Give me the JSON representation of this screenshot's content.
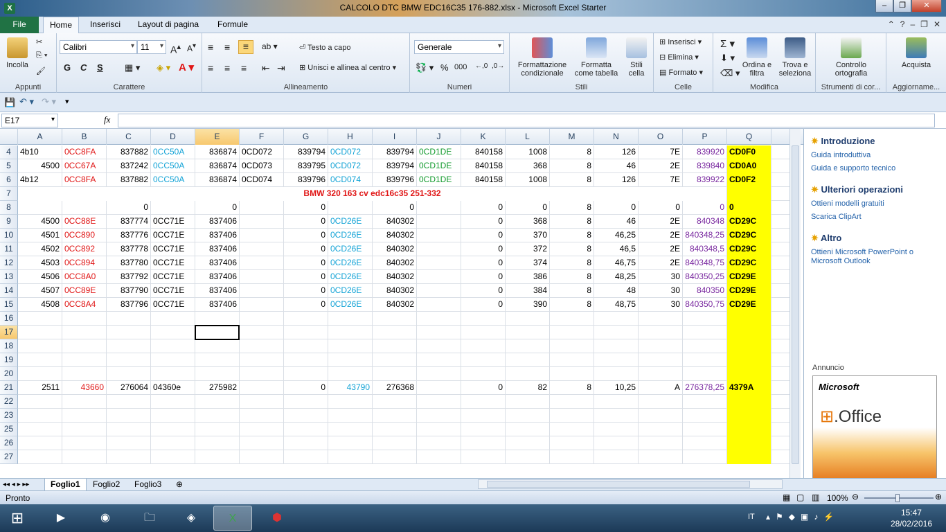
{
  "window": {
    "title": "CALCOLO DTC BMW EDC16C35 176-882.xlsx  -  Microsoft Excel Starter"
  },
  "tabs": {
    "file": "File",
    "home": "Home",
    "insert": "Inserisci",
    "layout": "Layout di pagina",
    "formulas": "Formule"
  },
  "ribbon": {
    "clipboard": {
      "label": "Appunti",
      "paste": "Incolla"
    },
    "font": {
      "label": "Carattere",
      "name": "Calibri",
      "size": "11",
      "bold": "G",
      "italic": "C",
      "underline": "S"
    },
    "alignment": {
      "label": "Allineamento",
      "wrap": "Testo a capo",
      "merge": "Unisci e allinea al centro"
    },
    "number": {
      "label": "Numeri",
      "format": "Generale",
      "pct": "%",
      "thousands": "000"
    },
    "styles": {
      "label": "Stili",
      "cond": "Formattazione condizionale",
      "table": "Formatta come tabella",
      "cell": "Stili cella"
    },
    "cells": {
      "label": "Celle",
      "insert": "Inserisci",
      "delete": "Elimina",
      "format": "Formato"
    },
    "editing": {
      "label": "Modifica",
      "sort": "Ordina e filtra",
      "find": "Trova e seleziona"
    },
    "proofing": {
      "label": "Strumenti di cor...",
      "spell": "Controllo ortografia"
    },
    "update": {
      "label": "Aggiorname...",
      "buy": "Acquista"
    }
  },
  "formula_bar": {
    "name_box": "E17",
    "fx": "fx",
    "value": ""
  },
  "columns": [
    "A",
    "B",
    "C",
    "D",
    "E",
    "F",
    "G",
    "H",
    "I",
    "J",
    "K",
    "L",
    "M",
    "N",
    "O",
    "P",
    "Q"
  ],
  "rows": [
    {
      "n": "4",
      "c": [
        "4b10",
        "0CC8FA",
        "837882",
        "0CC50A",
        "836874",
        "0CD072",
        "839794",
        "0CD072",
        "839794",
        "0CD1DE",
        "840158",
        "1008",
        "8",
        "126",
        "7E",
        "839920",
        "CD0F0"
      ]
    },
    {
      "n": "5",
      "c": [
        "4500",
        "0CC67A",
        "837242",
        "0CC50A",
        "836874",
        "0CD073",
        "839795",
        "0CD072",
        "839794",
        "0CD1DE",
        "840158",
        "368",
        "8",
        "46",
        "2E",
        "839840",
        "CD0A0"
      ]
    },
    {
      "n": "6",
      "c": [
        "4b12",
        "0CC8FA",
        "837882",
        "0CC50A",
        "836874",
        "0CD074",
        "839796",
        "0CD074",
        "839796",
        "0CD1DE",
        "840158",
        "1008",
        "8",
        "126",
        "7E",
        "839922",
        "CD0F2"
      ]
    },
    {
      "n": "7",
      "c": [
        "",
        "",
        "",
        "",
        "",
        "",
        "",
        "",
        "",
        "",
        "",
        "",
        "",
        "",
        "",
        "",
        ""
      ],
      "title": "BMW 320 163 cv edc16c35  251-332"
    },
    {
      "n": "8",
      "c": [
        "",
        "",
        "0",
        "",
        "0",
        "",
        "0",
        "",
        "0",
        "",
        "0",
        "0",
        "8",
        "0",
        "0",
        "0",
        "0"
      ]
    },
    {
      "n": "9",
      "c": [
        "4500",
        "0CC88E",
        "837774",
        "0CC71E",
        "837406",
        "",
        "0",
        "0CD26E",
        "840302",
        "",
        "0",
        "368",
        "8",
        "46",
        "2E",
        "840348",
        "CD29C"
      ]
    },
    {
      "n": "10",
      "c": [
        "4501",
        "0CC890",
        "837776",
        "0CC71E",
        "837406",
        "",
        "0",
        "0CD26E",
        "840302",
        "",
        "0",
        "370",
        "8",
        "46,25",
        "2E",
        "840348,25",
        "CD29C"
      ]
    },
    {
      "n": "11",
      "c": [
        "4502",
        "0CC892",
        "837778",
        "0CC71E",
        "837406",
        "",
        "0",
        "0CD26E",
        "840302",
        "",
        "0",
        "372",
        "8",
        "46,5",
        "2E",
        "840348,5",
        "CD29C"
      ]
    },
    {
      "n": "12",
      "c": [
        "4503",
        "0CC894",
        "837780",
        "0CC71E",
        "837406",
        "",
        "0",
        "0CD26E",
        "840302",
        "",
        "0",
        "374",
        "8",
        "46,75",
        "2E",
        "840348,75",
        "CD29C"
      ]
    },
    {
      "n": "13",
      "c": [
        "4506",
        "0CC8A0",
        "837792",
        "0CC71E",
        "837406",
        "",
        "0",
        "0CD26E",
        "840302",
        "",
        "0",
        "386",
        "8",
        "48,25",
        "30",
        "840350,25",
        "CD29E"
      ]
    },
    {
      "n": "14",
      "c": [
        "4507",
        "0CC89E",
        "837790",
        "0CC71E",
        "837406",
        "",
        "0",
        "0CD26E",
        "840302",
        "",
        "0",
        "384",
        "8",
        "48",
        "30",
        "840350",
        "CD29E"
      ]
    },
    {
      "n": "15",
      "c": [
        "4508",
        "0CC8A4",
        "837796",
        "0CC71E",
        "837406",
        "",
        "0",
        "0CD26E",
        "840302",
        "",
        "0",
        "390",
        "8",
        "48,75",
        "30",
        "840350,75",
        "CD29E"
      ]
    },
    {
      "n": "16",
      "c": [
        "",
        "",
        "",
        "",
        "",
        "",
        "",
        "",
        "",
        "",
        "",
        "",
        "",
        "",
        "",
        "",
        ""
      ]
    },
    {
      "n": "17",
      "c": [
        "",
        "",
        "",
        "",
        "",
        "",
        "",
        "",
        "",
        "",
        "",
        "",
        "",
        "",
        "",
        "",
        ""
      ]
    },
    {
      "n": "18",
      "c": [
        "",
        "",
        "",
        "",
        "",
        "",
        "",
        "",
        "",
        "",
        "",
        "",
        "",
        "",
        "",
        "",
        ""
      ]
    },
    {
      "n": "19",
      "c": [
        "",
        "",
        "",
        "",
        "",
        "",
        "",
        "",
        "",
        "",
        "",
        "",
        "",
        "",
        "",
        "",
        ""
      ]
    },
    {
      "n": "20",
      "c": [
        "",
        "",
        "",
        "",
        "",
        "",
        "",
        "",
        "",
        "",
        "",
        "",
        "",
        "",
        "",
        "",
        ""
      ]
    },
    {
      "n": "21",
      "c": [
        "2511",
        "43660",
        "276064",
        "04360e",
        "275982",
        "",
        "0",
        "43790",
        "276368",
        "",
        "0",
        "82",
        "8",
        "10,25",
        "A",
        "276378,25",
        "4379A"
      ]
    },
    {
      "n": "22",
      "c": [
        "",
        "",
        "",
        "",
        "",
        "",
        "",
        "",
        "",
        "",
        "",
        "",
        "",
        "",
        "",
        "",
        ""
      ]
    },
    {
      "n": "23",
      "c": [
        "",
        "",
        "",
        "",
        "",
        "",
        "",
        "",
        "",
        "",
        "",
        "",
        "",
        "",
        "",
        "",
        ""
      ]
    },
    {
      "n": "25",
      "c": [
        "",
        "",
        "",
        "",
        "",
        "",
        "",
        "",
        "",
        "",
        "",
        "",
        "",
        "",
        "",
        "",
        ""
      ]
    },
    {
      "n": "26",
      "c": [
        "",
        "",
        "",
        "",
        "",
        "",
        "",
        "",
        "",
        "",
        "",
        "",
        "",
        "",
        "",
        "",
        ""
      ]
    },
    {
      "n": "27",
      "c": [
        "",
        "",
        "",
        "",
        "",
        "",
        "",
        "",
        "",
        "",
        "",
        "",
        "",
        "",
        "",
        "",
        ""
      ]
    }
  ],
  "panel": {
    "intro": "Introduzione",
    "intro_links": [
      "Guida introduttiva",
      "Guida e supporto tecnico"
    ],
    "more": "Ulteriori operazioni",
    "more_links": [
      "Ottieni modelli gratuiti",
      "Scarica ClipArt"
    ],
    "other": "Altro",
    "other_link": "Ottieni Microsoft PowerPoint o Microsoft Outlook",
    "ad_label": "Annuncio",
    "ad_brand": "Microsoft",
    "ad_product": ".Office"
  },
  "sheets": [
    "Foglio1",
    "Foglio2",
    "Foglio3"
  ],
  "status": {
    "ready": "Pronto",
    "zoom": "100%"
  },
  "taskbar": {
    "lang": "IT",
    "time": "15:47",
    "date": "28/02/2016"
  },
  "colors": {
    "yellow": "#ffff00",
    "red": "#e01616",
    "cyan": "#13a3d6",
    "green": "#119a2c",
    "purple": "#7a2aa0"
  }
}
